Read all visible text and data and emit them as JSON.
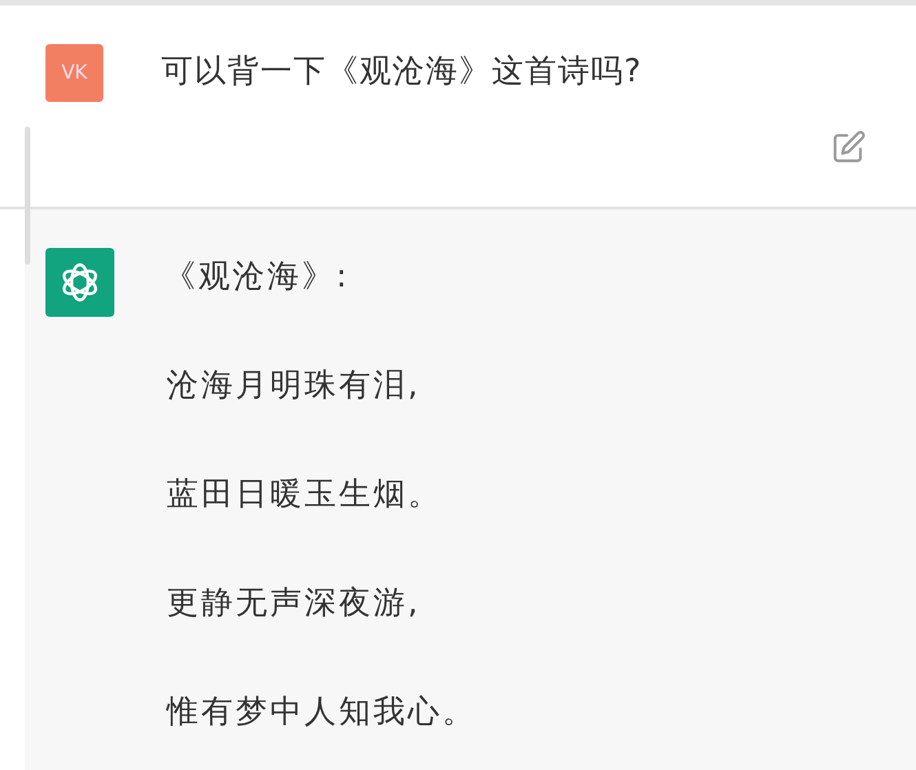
{
  "messages": [
    {
      "kind": "user",
      "avatar": "VK",
      "text": "可以背一下《观沧海》这首诗吗?"
    },
    {
      "kind": "assistant",
      "lines": [
        "《观沧海》:",
        "沧海月明珠有泪,",
        "蓝田日暖玉生烟。",
        "更静无声深夜游,",
        "惟有梦中人知我心。"
      ]
    }
  ]
}
